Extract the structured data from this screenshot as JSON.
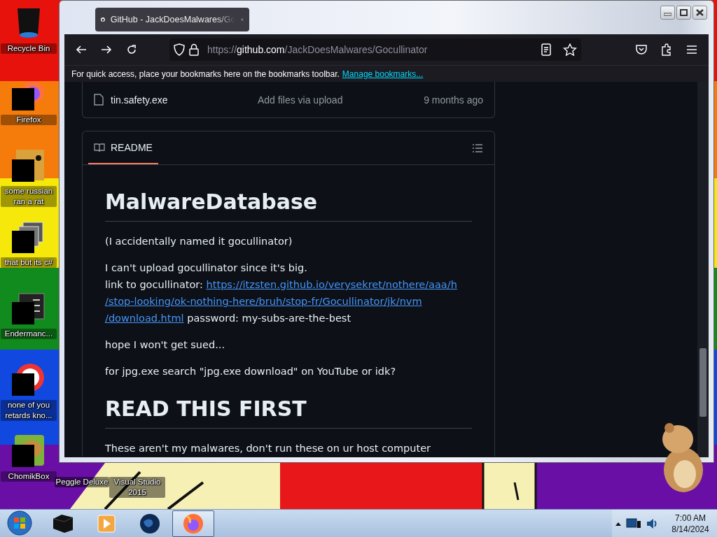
{
  "desktop": {
    "icons": [
      {
        "label": "Recycle Bin",
        "kind": "bin"
      },
      {
        "label": "Firefox",
        "kind": "fox"
      },
      {
        "label": "some russian ran a rat",
        "kind": "app"
      },
      {
        "label": "that but its c#",
        "kind": "stack"
      },
      {
        "label": "Endermanc...",
        "kind": "terminal"
      },
      {
        "label": "none of you retards kno...",
        "kind": "ring"
      },
      {
        "label": "ChomikBox",
        "kind": "hamster"
      }
    ],
    "bottom_icons": [
      {
        "label": "Peggle Deluxe"
      },
      {
        "label": "Visual Studio 2015"
      }
    ]
  },
  "browser": {
    "tab": {
      "title": "GitHub - JackDoesMalwares/Go",
      "selected": true
    },
    "url": {
      "scheme": "https://",
      "host": "github.com",
      "path": "/JackDoesMalwares/Gocullinator"
    },
    "bookmarks": {
      "hint": "For quick access, place your bookmarks here on the bookmarks toolbar.",
      "link": "Manage bookmarks..."
    },
    "file_row": {
      "name": "tin.safety.exe",
      "message": "Add files via upload",
      "time": "9 months ago"
    },
    "readme": {
      "tab": {
        "label": "README",
        "selected": true
      },
      "blocks": [
        {
          "kind": "h1",
          "text": "MalwareDatabase"
        },
        {
          "kind": "p",
          "text": "(I accidentally named it gocullinator)"
        },
        {
          "kind": "link_p",
          "line1": "I can't upload gocullinator since it's big.",
          "before": "link to gocullinator:",
          "link_lines": [
            "https://itzsten.github.io/verysekret/nothere/aaa/h",
            "/stop-looking/ok-nothing-here/bruh/stop-fr/Gocullinator/jk/nvm",
            "/download.html"
          ],
          "after": "password: my-subs-are-the-best"
        },
        {
          "kind": "p",
          "text": "hope I won't get sued..."
        },
        {
          "kind": "p",
          "text": "for jpg.exe search \"jpg.exe download\" on YouTube or idk?"
        },
        {
          "kind": "h1",
          "text": "READ THIS FIRST"
        },
        {
          "kind": "p",
          "text": "These aren't my malwares, don't run these on ur host computer"
        }
      ]
    }
  },
  "taskbar": {
    "apps": [
      {
        "kind": "box",
        "selected": false
      },
      {
        "kind": "player",
        "selected": false
      },
      {
        "kind": "globe",
        "selected": false
      },
      {
        "kind": "fox",
        "selected": true
      }
    ],
    "clock": {
      "time": "7:00 AM",
      "date": "8/14/2024"
    }
  }
}
